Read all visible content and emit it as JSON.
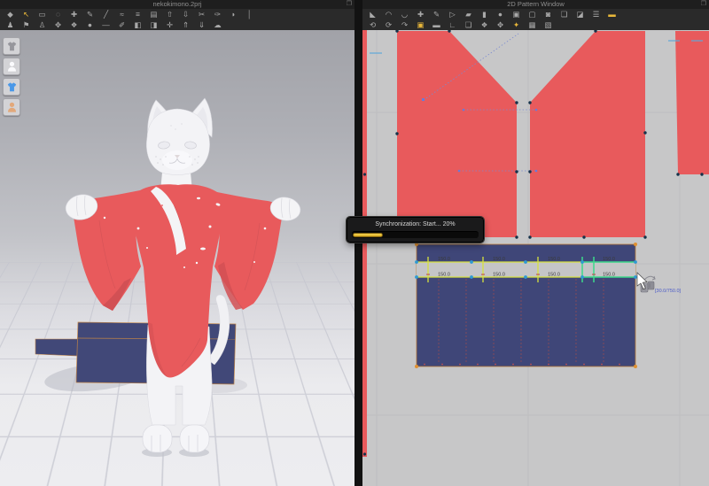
{
  "left_panel": {
    "title": "nekokimono.2prj",
    "window_icon": "❐",
    "toolbar_row1": [
      {
        "n": "simulate",
        "g": "◆"
      },
      {
        "n": "select-move",
        "g": "↖",
        "a": true
      },
      {
        "n": "select-box",
        "g": "▭"
      },
      {
        "n": "select-lasso",
        "g": "◌"
      },
      {
        "n": "pin",
        "g": "✚"
      },
      {
        "n": "pen-3d",
        "g": "✎"
      },
      {
        "n": "edit-seam",
        "g": "╱"
      },
      {
        "n": "segment-sewing",
        "g": "≈"
      },
      {
        "n": "free-sewing",
        "g": "≡"
      },
      {
        "n": "garment",
        "g": "▤"
      },
      {
        "n": "arrange-up",
        "g": "⇧"
      },
      {
        "n": "arrange-down",
        "g": "⇩"
      },
      {
        "n": "scissors",
        "g": "✂"
      },
      {
        "n": "tack",
        "g": "✑"
      },
      {
        "n": "steam",
        "g": "◗"
      },
      {
        "n": "bar",
        "g": "│"
      }
    ],
    "toolbar_row2": [
      {
        "n": "avatar",
        "g": "♟"
      },
      {
        "n": "pose",
        "g": "⚑"
      },
      {
        "n": "mannequin",
        "g": "♙"
      },
      {
        "n": "wind",
        "g": "✥"
      },
      {
        "n": "fabric",
        "g": "❖"
      },
      {
        "n": "ball",
        "g": "●"
      },
      {
        "n": "dash",
        "g": "—"
      },
      {
        "n": "tape",
        "g": "✐"
      },
      {
        "n": "flatten-left",
        "g": "◧"
      },
      {
        "n": "flatten-right",
        "g": "◨"
      },
      {
        "n": "align",
        "g": "✛"
      },
      {
        "n": "lift-up",
        "g": "⇑"
      },
      {
        "n": "lift-down",
        "g": "⇓"
      },
      {
        "n": "cloud",
        "g": "☁"
      }
    ],
    "side_buttons": [
      {
        "n": "show-garment",
        "kind": "shirt",
        "c": "#96969c"
      },
      {
        "n": "show-avatar",
        "kind": "person",
        "c": "#fafafc"
      },
      {
        "n": "show-cloth",
        "kind": "shirt",
        "c": "#4a98e8"
      },
      {
        "n": "show-skin",
        "kind": "person",
        "c": "#e2a87a"
      }
    ]
  },
  "right_panel": {
    "title": "2D Pattern Window",
    "window_icon": "❐",
    "toolbar_row1": [
      {
        "n": "transform-pattern",
        "g": "◣"
      },
      {
        "n": "edit-point",
        "g": "◠"
      },
      {
        "n": "edit-curvature",
        "g": "◡"
      },
      {
        "n": "add-point",
        "g": "✚"
      },
      {
        "n": "pen-2d",
        "g": "✎"
      },
      {
        "n": "poly-pen",
        "g": "▷"
      },
      {
        "n": "polygon",
        "g": "▰"
      },
      {
        "n": "rectangle",
        "g": "▮"
      },
      {
        "n": "circle",
        "g": "●"
      },
      {
        "n": "dart",
        "g": "▣"
      },
      {
        "n": "rounded-rect",
        "g": "▢"
      },
      {
        "n": "hole",
        "g": "◙"
      },
      {
        "n": "grading",
        "g": "❏"
      },
      {
        "n": "notch",
        "g": "◪"
      },
      {
        "n": "pleats",
        "g": "☰"
      },
      {
        "n": "trace",
        "g": "▬",
        "a": true
      }
    ],
    "toolbar_row2": [
      {
        "n": "unfold",
        "g": "⟲"
      },
      {
        "n": "fold-arrange",
        "g": "⟳"
      },
      {
        "n": "fold-3d",
        "g": "↷"
      },
      {
        "n": "edit-sewing",
        "g": "▣",
        "a": true
      },
      {
        "n": "iron",
        "g": "▬"
      },
      {
        "n": "seam-tape",
        "g": "∟"
      },
      {
        "n": "outline",
        "g": "❏"
      },
      {
        "n": "texture",
        "g": "❖"
      },
      {
        "n": "symmetry",
        "g": "✥"
      },
      {
        "n": "sparkle",
        "g": "✦",
        "a": true
      },
      {
        "n": "grid-quad",
        "g": "▦"
      },
      {
        "n": "grid-diag",
        "g": "▧"
      }
    ],
    "measurements": {
      "top": [
        "150.0",
        "150.0",
        "150.0",
        "150.0"
      ],
      "bottom": [
        "150.0",
        "150.0",
        "150.0",
        "150.0"
      ],
      "cursor_tooltip": "[30.0/750.0]"
    }
  },
  "sync_toast": {
    "message": "Synchronization: Start... 20%",
    "progress_percent": 24
  },
  "colors": {
    "red": "#e85a5c",
    "red-dark": "#d25054",
    "navy": "#414878",
    "navy2d": "#3f4678",
    "accent": "#e8b73a",
    "tick-yellow": "#d6e23e",
    "tick-green": "#3cd88a",
    "orange": "#e09030",
    "bg2d": "#c7c7c8",
    "grid2d": "#bababc",
    "blue-dot": "#2e9ad2",
    "dash-blue": "#7b8ad0",
    "dash-red": "#a34e4e",
    "point-dark": "#15324a",
    "tooltip-blue": "#4a5ac8"
  }
}
